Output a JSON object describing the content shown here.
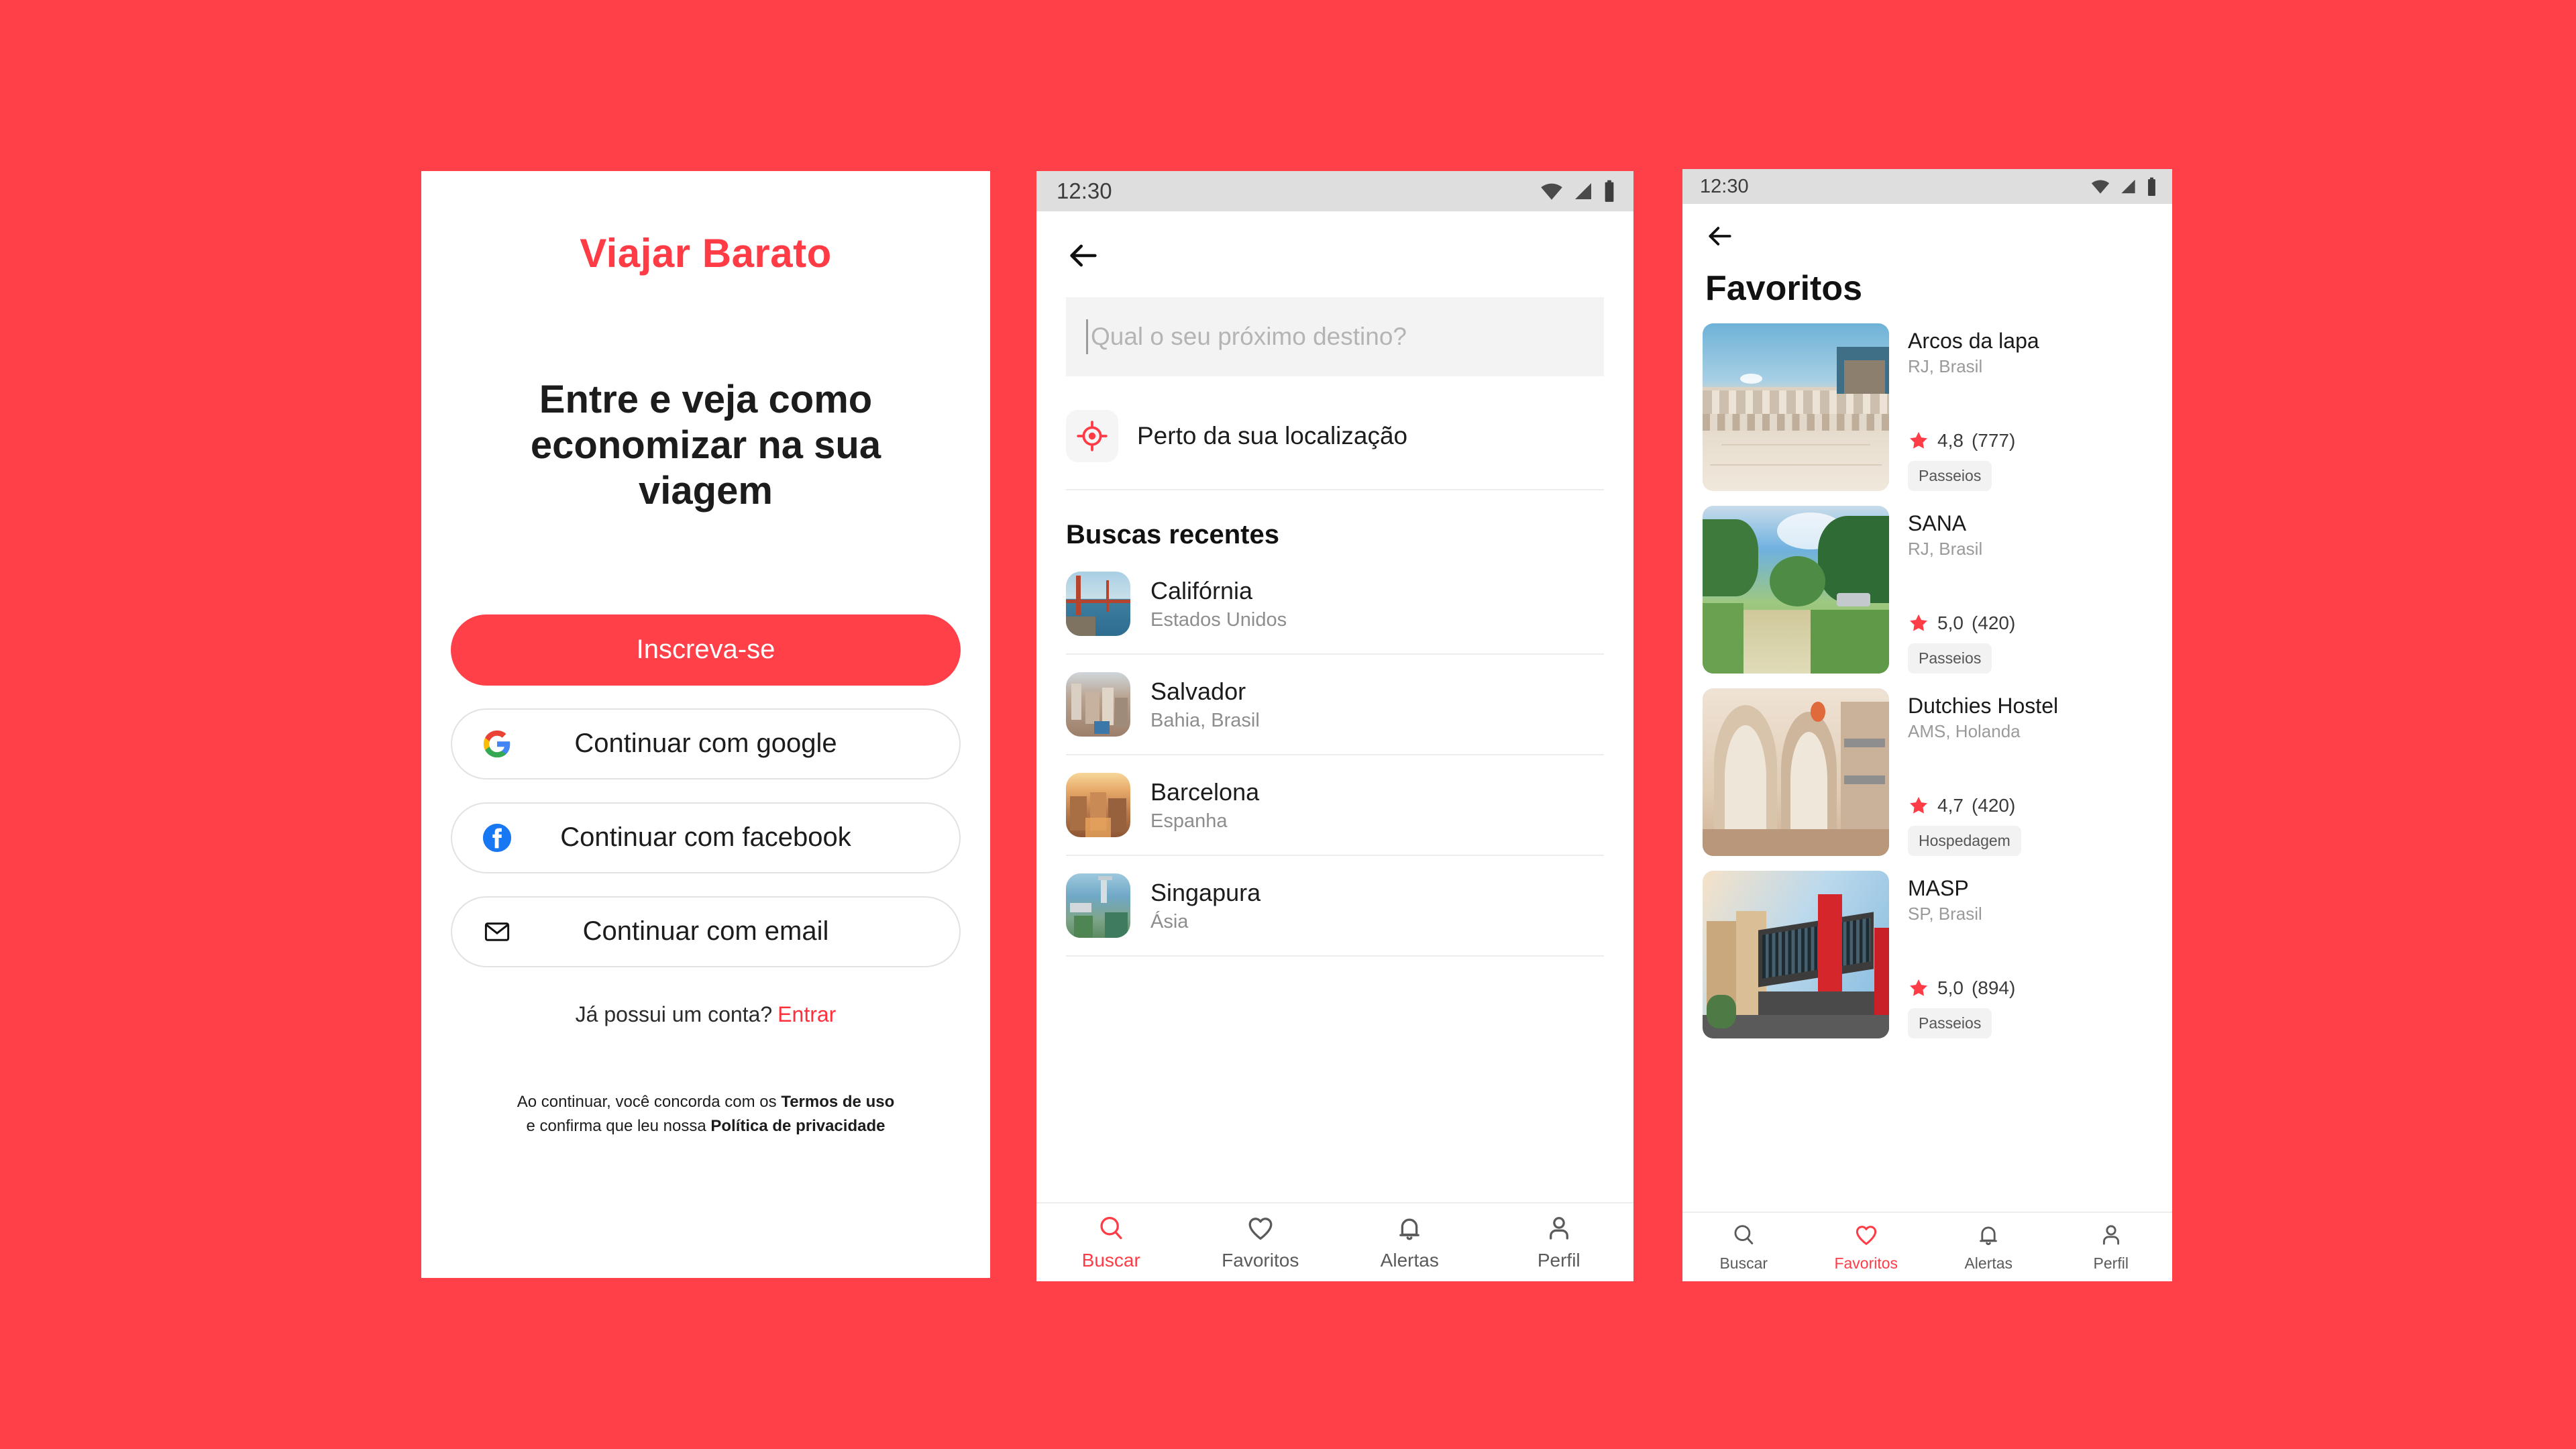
{
  "theme": {
    "brand_red": "#FF4049",
    "accent_red": "#FF3B46",
    "bg": "#FF4049"
  },
  "login_screen": {
    "brand_title": "Viajar  Barato",
    "headline": "Entre e veja como economizar na sua viagem",
    "signup_button": "Inscreva-se",
    "social_buttons": [
      {
        "label": "Continuar com google",
        "icon": "google-icon"
      },
      {
        "label": "Continuar com facebook",
        "icon": "facebook-icon"
      },
      {
        "label": "Continuar com email",
        "icon": "envelope-icon"
      }
    ],
    "account_prompt": "Já possui um conta?",
    "login_link": "Entrar",
    "legal_line1_prefix": "Ao continuar, você concorda com os ",
    "legal_line1_bold": "Termos de uso",
    "legal_line2_prefix": "e confirma que leu nossa ",
    "legal_line2_bold": "Política de privacidade"
  },
  "search_screen": {
    "status_bar": {
      "time": "12:30",
      "icons": [
        "wifi-icon",
        "signal-icon",
        "battery-icon"
      ]
    },
    "back_button": "back-arrow-icon",
    "search_placeholder": "Qual o seu próximo destino?",
    "search_value": "",
    "near_location_label": "Perto da sua localização",
    "recent_title": "Buscas recentes",
    "recent_items": [
      {
        "name": "Califórnia",
        "sub": "Estados Unidos",
        "image": "golden-gate-bridge"
      },
      {
        "name": "Salvador",
        "sub": "Bahia, Brasil",
        "image": "salvador-pelourinho"
      },
      {
        "name": "Barcelona",
        "sub": "Espanha",
        "image": "barcelona-aerial"
      },
      {
        "name": "Singapura",
        "sub": "Ásia",
        "image": "singapore-marina"
      }
    ],
    "bottom_nav": [
      {
        "label": "Buscar",
        "icon": "search-icon",
        "active": true
      },
      {
        "label": "Favoritos",
        "icon": "heart-icon",
        "active": false
      },
      {
        "label": "Alertas",
        "icon": "bell-icon",
        "active": false
      },
      {
        "label": "Perfil",
        "icon": "person-icon",
        "active": false
      }
    ]
  },
  "favorites_screen": {
    "status_bar": {
      "time": "12:30",
      "icons": [
        "wifi-icon",
        "signal-icon",
        "battery-icon"
      ]
    },
    "back_button": "back-arrow-icon",
    "title": "Favoritos",
    "cards": [
      {
        "name": "Arcos da lapa",
        "location": "RJ, Brasil",
        "rating": "4,8",
        "reviews": "(777)",
        "tag": "Passeios",
        "image": "arcos-da-lapa"
      },
      {
        "name": "SANA",
        "location": "RJ, Brasil",
        "rating": "5,0",
        "reviews": "(420)",
        "tag": "Passeios",
        "image": "sana-nature"
      },
      {
        "name": "Dutchies Hostel",
        "location": "AMS, Holanda",
        "rating": "4,7",
        "reviews": "(420)",
        "tag": "Hospedagem",
        "image": "hostel-interior"
      },
      {
        "name": "MASP",
        "location": "SP, Brasil",
        "rating": "5,0",
        "reviews": "(894)",
        "tag": "Passeios",
        "image": "masp-building"
      }
    ],
    "bottom_nav": [
      {
        "label": "Buscar",
        "icon": "search-icon",
        "active": false
      },
      {
        "label": "Favoritos",
        "icon": "heart-icon",
        "active": true
      },
      {
        "label": "Alertas",
        "icon": "bell-icon",
        "active": false
      },
      {
        "label": "Perfil",
        "icon": "person-icon",
        "active": false
      }
    ]
  }
}
